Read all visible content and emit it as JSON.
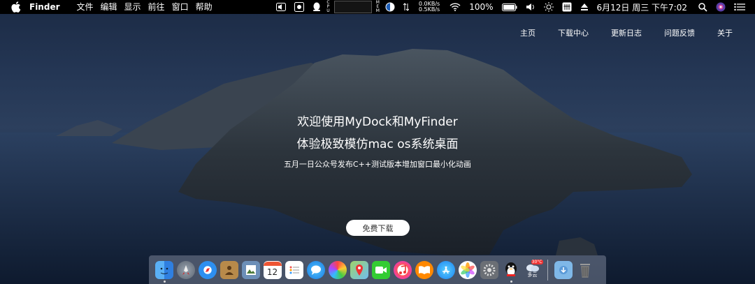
{
  "menubar": {
    "app_name": "Finder",
    "menus": [
      "文件",
      "编辑",
      "显示",
      "前往",
      "窗口",
      "帮助"
    ],
    "net_up": "0.0KB/s",
    "net_down": "0.5KB/s",
    "battery": "100%",
    "datetime": "6月12日 周三 下午7:02"
  },
  "nav": [
    "主页",
    "下载中心",
    "更新日志",
    "问题反馈",
    "关于"
  ],
  "hero": {
    "title_line1": "欢迎使用MyDock和MyFinder",
    "title_line2": "体验极致模仿mac os系统桌面",
    "subtitle": "五月一日公众号发布C++测试版本增加窗口最小化动画",
    "download_button": "免费下载"
  },
  "dock": {
    "calendar_day": "12",
    "weather_label": "多云",
    "weather_badge": "30°C"
  },
  "colors": {
    "menubar_bg": "#000000",
    "button_bg": "#ffffff",
    "dock_bg": "rgba(120,130,150,0.55)"
  }
}
